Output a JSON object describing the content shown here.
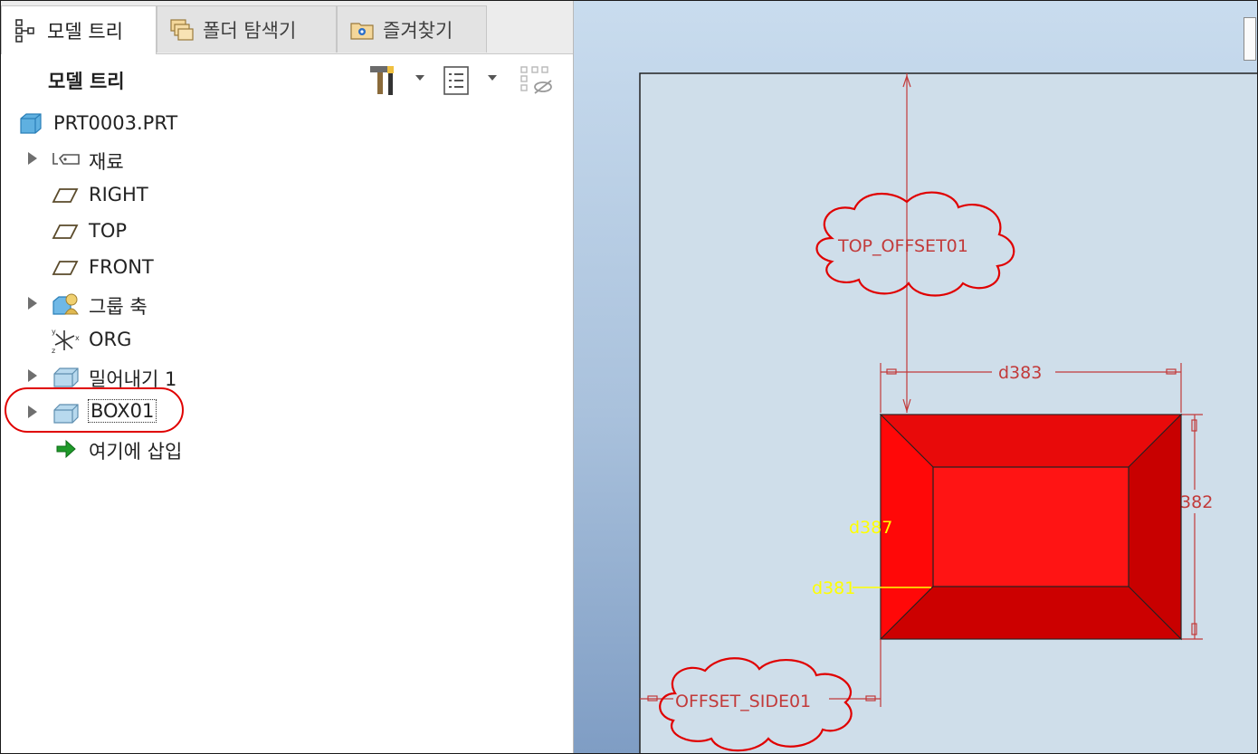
{
  "tabs": [
    {
      "label": "모델 트리",
      "icon": "model-tree-icon",
      "active": true
    },
    {
      "label": "폴더 탐색기",
      "icon": "folder-browser-icon",
      "active": false
    },
    {
      "label": "즐겨찾기",
      "icon": "favorites-icon",
      "active": false
    }
  ],
  "panel": {
    "title": "모델 트리",
    "tools": [
      "settings-tools-icon",
      "show-options-icon",
      "filter-icon"
    ]
  },
  "tree": {
    "items": [
      {
        "label": "PRT0003.PRT",
        "icon": "part-icon",
        "expandable": false
      },
      {
        "label": "재료",
        "icon": "material-tag-icon",
        "expandable": true
      },
      {
        "label": "RIGHT",
        "icon": "datum-plane-icon",
        "expandable": false
      },
      {
        "label": "TOP",
        "icon": "datum-plane-icon",
        "expandable": false
      },
      {
        "label": "FRONT",
        "icon": "datum-plane-icon",
        "expandable": false
      },
      {
        "label": "그룹 축",
        "icon": "group-axis-icon",
        "expandable": true
      },
      {
        "label": "ORG",
        "icon": "coordinate-system-icon",
        "expandable": false
      },
      {
        "label": "밀어내기 1",
        "icon": "extrude-icon",
        "expandable": true
      },
      {
        "label": "BOX01",
        "icon": "extrude-icon",
        "expandable": true,
        "highlighted": true
      },
      {
        "label": "여기에 삽입",
        "icon": "insert-here-arrow-icon",
        "expandable": false
      }
    ]
  },
  "graphics": {
    "annotations": {
      "top_offset": "TOP_OFFSET01",
      "side_offset": "OFFSET_SIDE01",
      "d383": "d383",
      "d382": "d382",
      "d387": "d387",
      "d381": "d381"
    },
    "colors": {
      "dimension": "#c23a3a",
      "highlight": "#e00000",
      "selected_dim": "#ffff00",
      "box_face": "#ff1010",
      "box_side": "#d40000",
      "sketch_bg": "#cfdeea"
    }
  }
}
